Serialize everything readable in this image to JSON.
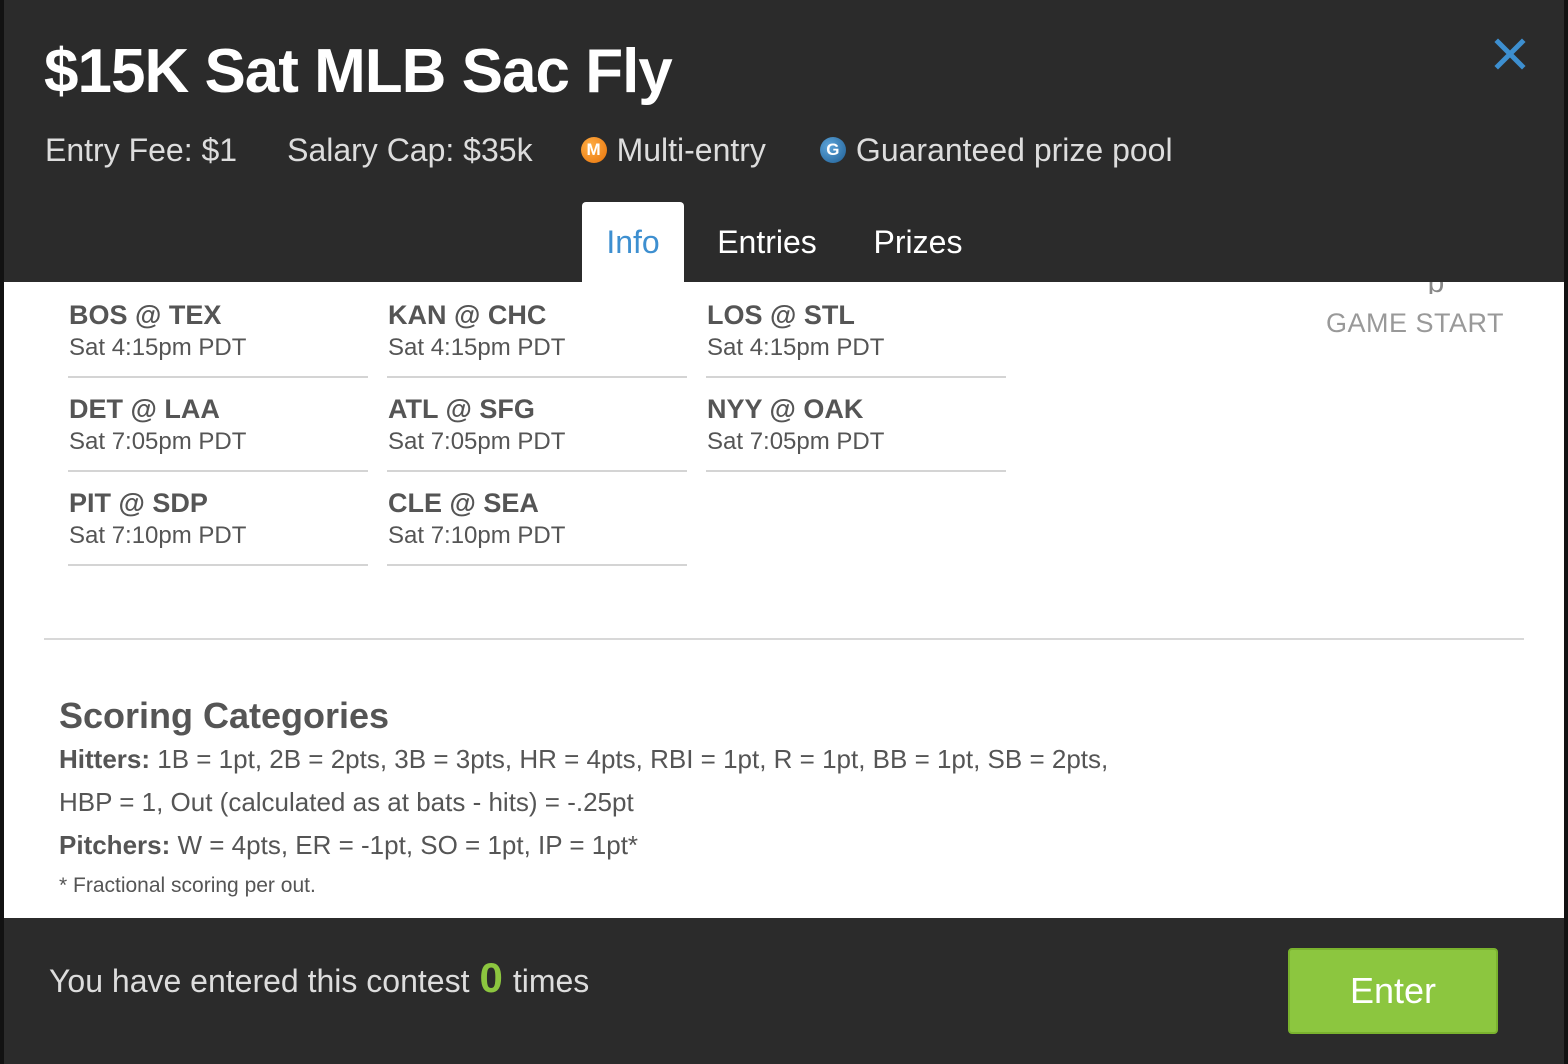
{
  "header": {
    "title": "$15K Sat MLB Sac Fly",
    "entry_fee": "Entry Fee: $1",
    "salary_cap": "Salary Cap: $35k",
    "multi_entry_badge": "M",
    "multi_entry_label": "Multi-entry",
    "guaranteed_badge": "G",
    "guaranteed_label": "Guaranteed prize pool"
  },
  "tabs": [
    {
      "label": "Info",
      "active": true
    },
    {
      "label": "Entries",
      "active": false
    },
    {
      "label": "Prizes",
      "active": false
    }
  ],
  "game_start_label": "GAME START",
  "games": [
    {
      "teams": "BOS @ TEX",
      "time": "Sat 4:15pm PDT"
    },
    {
      "teams": "KAN @ CHC",
      "time": "Sat 4:15pm PDT"
    },
    {
      "teams": "LOS @ STL",
      "time": "Sat 4:15pm PDT"
    },
    {
      "teams": "DET @ LAA",
      "time": "Sat 7:05pm PDT"
    },
    {
      "teams": "ATL @ SFG",
      "time": "Sat 7:05pm PDT"
    },
    {
      "teams": "NYY @ OAK",
      "time": "Sat 7:05pm PDT"
    },
    {
      "teams": "PIT @ SDP",
      "time": "Sat 7:10pm PDT"
    },
    {
      "teams": "CLE @ SEA",
      "time": "Sat 7:10pm PDT"
    }
  ],
  "scoring": {
    "heading": "Scoring Categories",
    "hitters_label": "Hitters:",
    "hitters_text": "1B = 1pt, 2B = 2pts, 3B = 3pts, HR = 4pts, RBI = 1pt, R = 1pt, BB = 1pt, SB = 2pts,",
    "hitters_text_2": "HBP = 1, Out (calculated as at bats - hits) = -.25pt",
    "pitchers_label": "Pitchers:",
    "pitchers_text": "W = 4pts, ER = -1pt, SO = 1pt, IP = 1pt*",
    "note": "* Fractional scoring per out."
  },
  "footer": {
    "entered_prefix": "You have entered this contest",
    "entered_count": "0",
    "entered_suffix": "times",
    "enter_button": "Enter"
  },
  "colors": {
    "accent_blue": "#3d8fd0",
    "enter_green": "#8cc63f",
    "multi_entry_orange": "#e8730a",
    "guaranteed_blue": "#1f5f95"
  },
  "icons": {
    "close": "close-icon"
  }
}
